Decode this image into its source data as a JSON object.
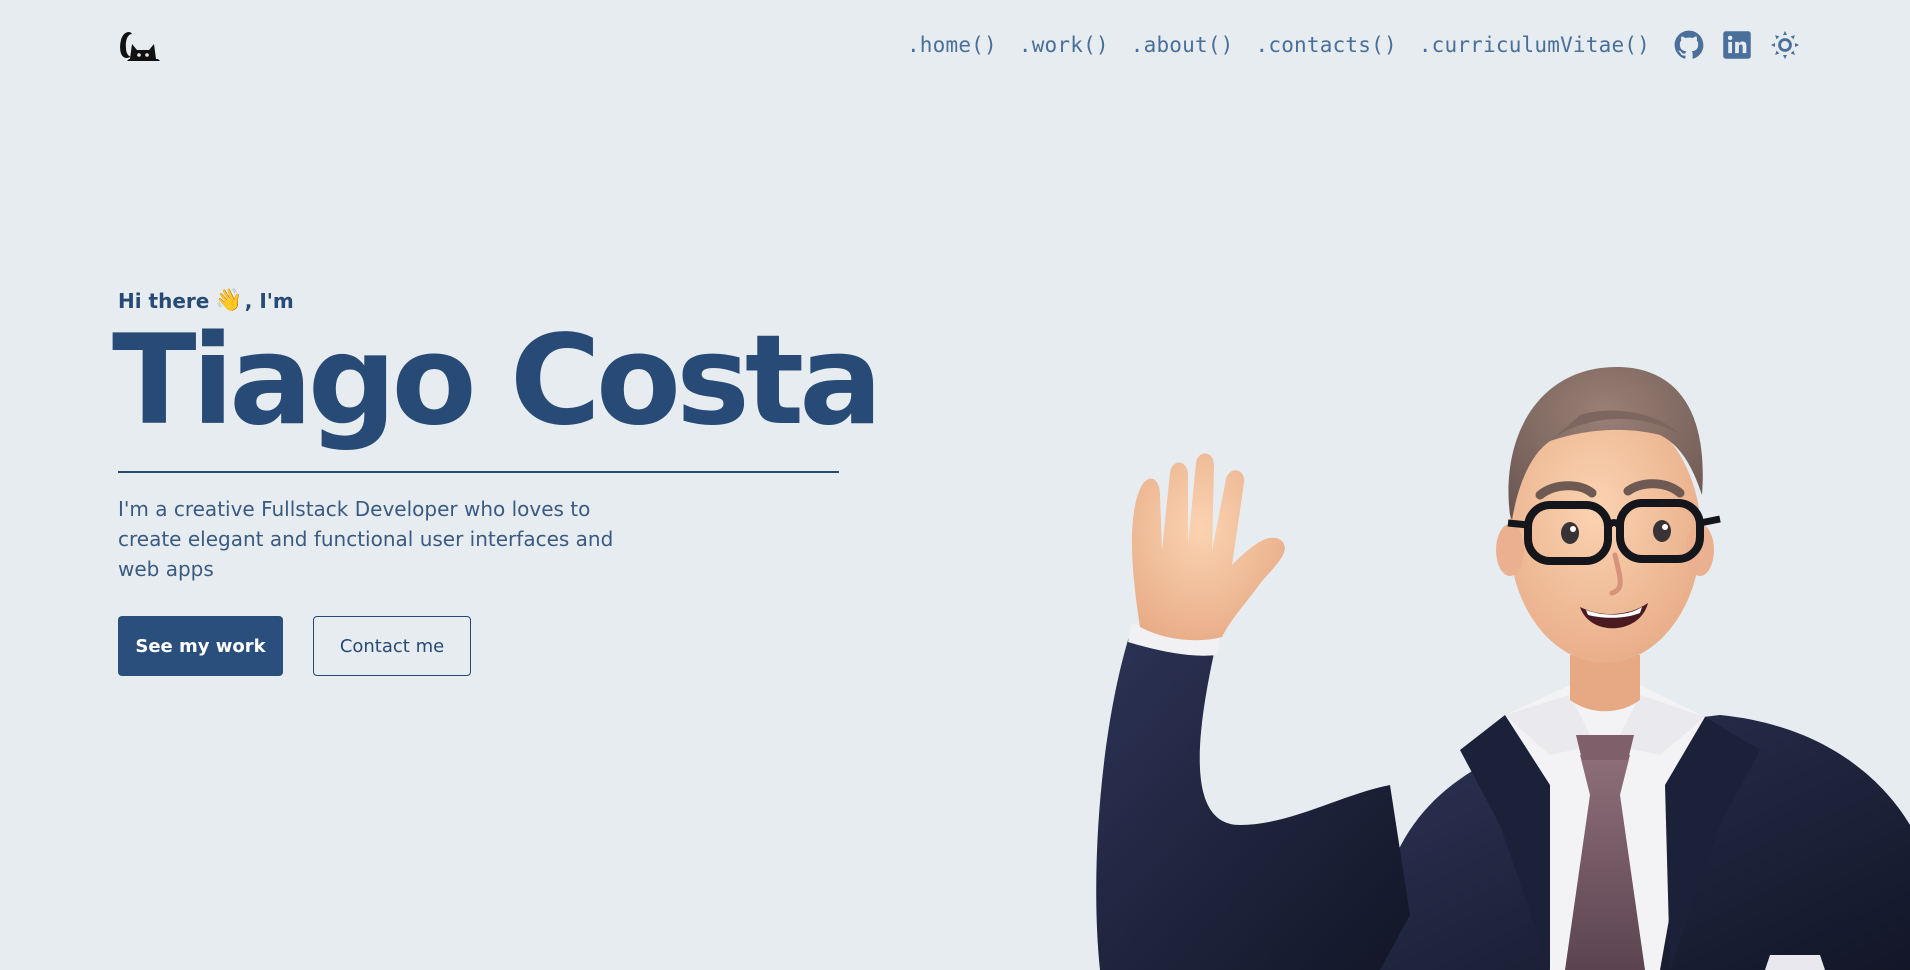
{
  "header": {
    "logo": "cat-logo-icon",
    "nav": [
      {
        "label": ".home()"
      },
      {
        "label": ".work()"
      },
      {
        "label": ".about()"
      },
      {
        "label": ".contacts()"
      },
      {
        "label": ".curriculumVitae()"
      }
    ],
    "icons": [
      "github-icon",
      "linkedin-icon",
      "sun-icon"
    ]
  },
  "hero": {
    "greeting_prefix": "Hi there",
    "wave": "👋",
    "greeting_suffix": ", I'm",
    "name": "Tiago Costa",
    "tagline": "I'm a creative Fullstack Developer who loves to create elegant and functional user interfaces and web apps",
    "primary_button": "See my work",
    "secondary_button": "Contact me"
  },
  "colors": {
    "background": "#e6ecef",
    "primary": "#274b76",
    "nav": "#4a6f9a"
  }
}
